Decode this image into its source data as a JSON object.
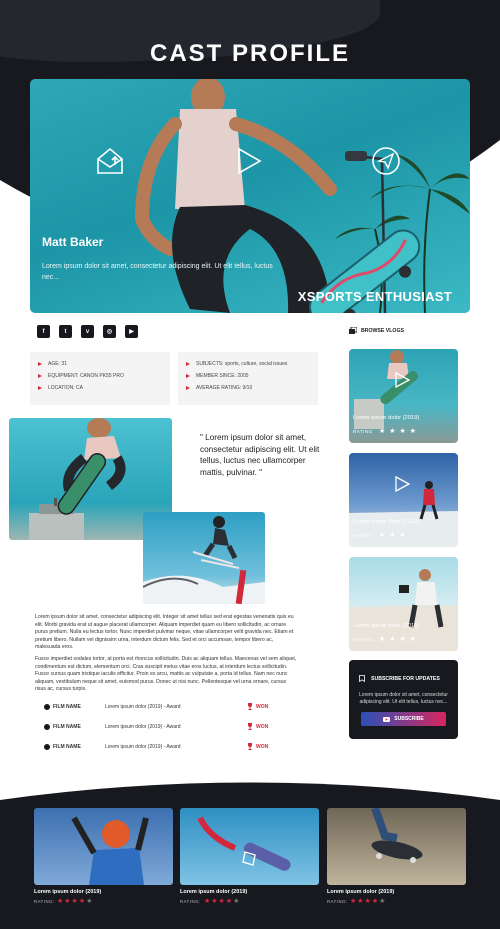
{
  "page": {
    "title": "CAST PROFILE"
  },
  "hero": {
    "name": "Matt Baker",
    "description": "Lorem ipsum dolor sit amet, consectetur adipiscing elit. Ut elit tellus, luctus nec...",
    "tagline": "XSPORTS ENTHUSIAST",
    "icons": [
      "envelope-open-icon",
      "play-icon",
      "send-icon"
    ]
  },
  "social": [
    {
      "icon": "facebook-icon",
      "glyph": "f"
    },
    {
      "icon": "twitter-icon",
      "glyph": "t"
    },
    {
      "icon": "vimeo-icon",
      "glyph": "v"
    },
    {
      "icon": "instagram-icon",
      "glyph": "◎"
    },
    {
      "icon": "youtube-icon",
      "glyph": "▶"
    }
  ],
  "info": {
    "left": [
      "AGE: 31",
      "EQUIPMENT: CANON PK55 PRO",
      "LOCATION: CA"
    ],
    "right": [
      "SUBJECTS: sports, culture, social issues",
      "MEMBER SINCE: 2005",
      "AVERAGE RATING: 9/10"
    ]
  },
  "quote": "\" Lorem ipsum dolor sit amet, consectetur adipiscing elit. Ut elit tellus, luctus nec ullamcorper mattis, pulvinar. \"",
  "paragraphs": [
    "Lorem ipsum dolor sit amet, consectetur adipiscing elit. Integer sit amet tellus sed erat egestas venenatis quis eu elit. Morbi gravida erat ut augue placerat ullamcorper. Aliquam imperdiet quam eu libero sollicitudin, ac ornare purus pretium. Nulla eu lectus tortor. Nunc imperdiet pulvinar neque, vitae ullamcorper velit gravida nec. Etiam et pretium libero. Nullam vel dignissim urna, interdum dictum felis. Sed et orci accumsan, tempor libero ac, malesuada eros.",
    "Fusce imperdiet sodales tortor, at porta est rhoncus sollicitudin. Duis ac aliquam tellus. Maecenas vel sem aliquet, condimentum est dictum, elementum orci. Cras suscipit metus vitae eros luctus, at interdum lectus sollicitudin. Fusce cursus quam tristique iaculis efficitur. Proin ex arcu, mattis ac vulputate a, porta id tellus. Nam nec nunc aliquam, vestibulum neque sit amet, euismod purus. Donec ut nisi nunc. Pellentesque vel urna ornare, cursus risus ac, cursus turpis."
  ],
  "awards": [
    {
      "label": "FILM NAME",
      "text": "Lorem ipsum dolor (2019) - Award",
      "status": "WON"
    },
    {
      "label": "FILM NAME",
      "text": "Lorem ipsum dolor (2019) - Award",
      "status": "WON"
    },
    {
      "label": "FILM NAME",
      "text": "Lorem ipsum dolor (2019) - Award",
      "status": "WON"
    }
  ],
  "sidebar": {
    "browse_label": "BROWSE VLOGS",
    "vlogs": [
      {
        "title": "Lorem ipsum dolor (2019)",
        "rating_label": "RATING",
        "stars": "★ ★ ★ ★",
        "rating": 4
      },
      {
        "title": "Lorem ipsum dolor (2019)",
        "rating_label": "RATING",
        "stars": "★ ★ ★",
        "rating": 3
      },
      {
        "title": "Lorem ipsum dolor (2019)",
        "rating_label": "RATING",
        "stars": "★ ★ ★ ★",
        "rating": 4
      }
    ],
    "subscribe": {
      "title": "SUBSCRIBE FOR UPDATES",
      "description": "Lorem ipsum dolor sit amet, consectetur adipiscing elit. Ut elit tellus, luctus nec...",
      "button": "SUBSCRIBE"
    }
  },
  "footer": {
    "cards": [
      {
        "title": "Lorem ipsum dolor (2019)",
        "rating_label": "RATING:",
        "rating": 4
      },
      {
        "title": "Lorem ipsum dolor (2019)",
        "rating_label": "RATING:",
        "rating": 4
      },
      {
        "title": "Lorem ipsum dolor (2019)",
        "rating_label": "RATING:",
        "rating": 4
      }
    ]
  },
  "colors": {
    "accent": "#d2283b",
    "dark": "#17191f",
    "hero": "#2ea8b7"
  }
}
